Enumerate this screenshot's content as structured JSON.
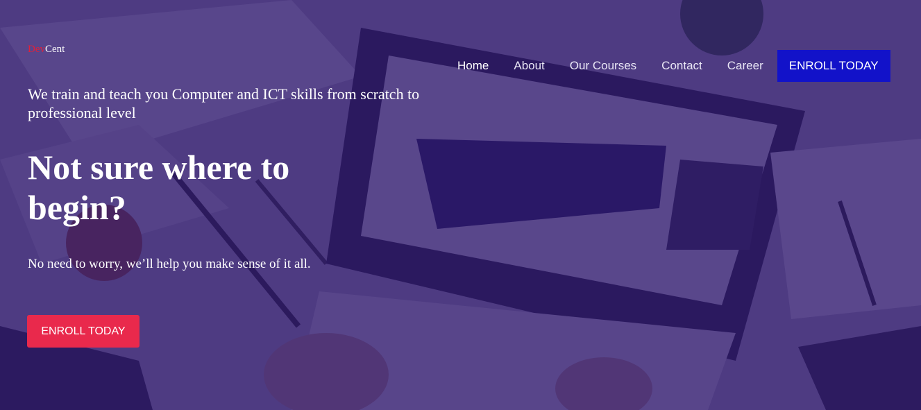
{
  "logo": {
    "part1": "Dev",
    "part2": "Cent"
  },
  "nav": {
    "items": [
      {
        "label": "Home"
      },
      {
        "label": "About"
      },
      {
        "label": "Our Courses"
      },
      {
        "label": "Contact"
      },
      {
        "label": "Career"
      }
    ],
    "enroll_label": "ENROLL TODAY"
  },
  "hero": {
    "tagline": "We train and teach you Computer and ICT skills from scratch to professional level",
    "headline": "Not sure where to begin?",
    "subtext": "No need to worry, we’ll help you make sense of it all.",
    "cta_label": "ENROLL TODAY"
  },
  "colors": {
    "overlay": "#30186e",
    "nav_enroll_bg": "#1212c9",
    "cta_bg": "#e9294c",
    "logo_accent": "#e0203a"
  }
}
